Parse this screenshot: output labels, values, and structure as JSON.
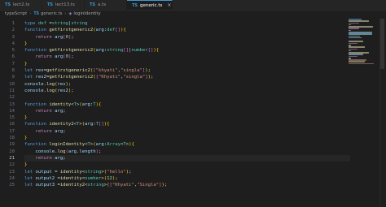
{
  "tabs": [
    {
      "label": "lect2.ts",
      "icon": "typescript-file-icon",
      "active": false
    },
    {
      "label": "lect13.ts",
      "icon": "typescript-file-icon",
      "active": false
    },
    {
      "label": "a.ts",
      "icon": "typescript-file-icon",
      "active": false
    },
    {
      "label": "generic.ts",
      "icon": "typescript-file-icon",
      "active": true,
      "close": "×"
    }
  ],
  "tab_icon_text": "TS",
  "breadcrumb": {
    "folder": "typeScript",
    "file": "generic.ts",
    "symbol": "loginIdentity"
  },
  "current_line": 21,
  "code_lines": [
    {
      "n": 1,
      "html": "<span class=\"kw\">type</span> <span class=\"ty\">def</span> <span class=\"pn\">=</span><span class=\"ty\">string</span><span class=\"pn\">|</span><span class=\"ty\">string</span>"
    },
    {
      "n": 2,
      "html": "<span class=\"kw\">function</span> <span class=\"fn\">getfirstgeneric2</span><span class=\"br1\">(</span><span class=\"var\">arg</span>:<span class=\"ty\">def</span><span class=\"br2\">[]</span><span class=\"br1\">)</span><span class=\"br1\">{</span>"
    },
    {
      "n": 3,
      "html": "    <span class=\"ctl\">return</span> <span class=\"var\">arg</span><span class=\"br2\">[</span><span class=\"num\">0</span><span class=\"br2\">]</span>;"
    },
    {
      "n": 4,
      "html": "<span class=\"br1\">}</span>"
    },
    {
      "n": 5,
      "html": "<span class=\"kw\">function</span> <span class=\"fn\">getfirstgeneric2</span><span class=\"br1\">(</span><span class=\"var\">arg</span>:<span class=\"ty\">string</span><span class=\"br2\">[]</span><span class=\"pn\">|</span><span class=\"ty\">number</span><span class=\"br2\">[]</span><span class=\"br1\">)</span><span class=\"br1\">{</span>"
    },
    {
      "n": 6,
      "html": "    <span class=\"ctl\">return</span> <span class=\"var\">arg</span><span class=\"br2\">[</span><span class=\"num\">0</span><span class=\"br2\">]</span>;"
    },
    {
      "n": 7,
      "html": "<span class=\"br1\">}</span>"
    },
    {
      "n": 8,
      "html": "<span class=\"kw\">let</span> <span class=\"var\">res</span><span class=\"pn\">=</span><span class=\"fn\">getfirstgeneric2</span><span class=\"br1\">(</span><span class=\"br2\">[</span><span class=\"str\">\"khyati\"</span>,<span class=\"str\">\"singla\"</span><span class=\"br2\">]</span><span class=\"br1\">)</span>;"
    },
    {
      "n": 9,
      "html": "<span class=\"kw\">let</span> <span class=\"var\">res2</span><span class=\"pn\">=</span><span class=\"fn\">getfirstgeneric2</span><span class=\"br1\">(</span><span class=\"br2\">[</span><span class=\"str\">\"Khyati\"</span>,<span class=\"str\">\"singla\"</span><span class=\"br2\">]</span><span class=\"br1\">)</span>;"
    },
    {
      "n": 10,
      "html": "<span class=\"var\">console</span>.<span class=\"fn\">log</span><span class=\"br1\">(</span><span class=\"var\">res</span><span class=\"br1\">)</span>;"
    },
    {
      "n": 11,
      "html": "<span class=\"var\">console</span>.<span class=\"fn\">log</span><span class=\"br1\">(</span><span class=\"var\">res2</span><span class=\"br1\">)</span>;"
    },
    {
      "n": 12,
      "html": ""
    },
    {
      "n": 13,
      "html": "<span class=\"kw\">function</span> <span class=\"fn\">identity</span><span class=\"pn\">&lt;</span><span class=\"ty\">T</span><span class=\"pn\">&gt;</span><span class=\"br1\">(</span><span class=\"var\">arg</span>:<span class=\"ty\">T</span><span class=\"br1\">)</span><span class=\"br1\">{</span>"
    },
    {
      "n": 14,
      "html": "    <span class=\"ctl\">return</span> <span class=\"var\">arg</span>;"
    },
    {
      "n": 15,
      "html": "<span class=\"br1\">}</span>"
    },
    {
      "n": 16,
      "html": "<span class=\"kw\">function</span> <span class=\"fn\">identity2</span><span class=\"pn\">&lt;</span><span class=\"ty\">T</span><span class=\"pn\">&gt;</span><span class=\"br1\">(</span><span class=\"var\">arg</span>:<span class=\"ty\">T</span><span class=\"br2\">[]</span><span class=\"br1\">)</span><span class=\"br1\">{</span>"
    },
    {
      "n": 17,
      "html": "    <span class=\"ctl\">return</span> <span class=\"var\">arg</span>;"
    },
    {
      "n": 18,
      "html": "<span class=\"br1\">}</span>"
    },
    {
      "n": 19,
      "html": "<span class=\"kw\">function</span> <span class=\"fn\">loginIdentity</span><span class=\"pn\">&lt;</span><span class=\"ty\">T</span><span class=\"pn\">&gt;</span><span class=\"br1\">(</span><span class=\"var\">arg</span>:<span class=\"ty\">Array</span><span class=\"pn\">&lt;</span><span class=\"ty\">T</span><span class=\"pn\">&gt;</span><span class=\"br1\">)</span><span class=\"br1\">{</span>"
    },
    {
      "n": 20,
      "html": "    <span class=\"var\">console</span>.<span class=\"fn\">log</span><span class=\"br2\">(</span><span class=\"var\">arg</span>.<span class=\"var\">length</span><span class=\"br2\">)</span>;"
    },
    {
      "n": 21,
      "html": "    <span class=\"ctl\">return</span> <span class=\"var\">arg</span>;"
    },
    {
      "n": 22,
      "html": "<span class=\"br1\">}</span>"
    },
    {
      "n": 23,
      "html": "<span class=\"kw\">let</span> <span class=\"var\">output</span> <span class=\"pn\">=</span> <span class=\"fn\">identity</span><span class=\"pn\">&lt;</span><span class=\"ty\">string</span><span class=\"pn\">&gt;</span><span class=\"br1\">(</span><span class=\"str\">\"hello\"</span><span class=\"br1\">)</span>;"
    },
    {
      "n": 24,
      "html": "<span class=\"kw\">let</span> <span class=\"var\">output2</span> <span class=\"pn\">=</span><span class=\"fn\">identity</span><span class=\"pn\">&lt;</span><span class=\"ty\">number</span><span class=\"pn\">&gt;</span><span class=\"br1\">(</span><span class=\"num\">12</span><span class=\"br1\">)</span>;"
    },
    {
      "n": 25,
      "html": "<span class=\"kw\">let</span> <span class=\"var\">output3</span> <span class=\"pn\">=</span><span class=\"fn\">identity2</span><span class=\"pn\">&lt;</span><span class=\"ty\">string</span><span class=\"pn\">&gt;</span><span class=\"br1\">(</span><span class=\"br2\">[</span><span class=\"str\">\"Khyati\"</span>,<span class=\"str\">\"Singla\"</span><span class=\"br2\">]</span><span class=\"br1\">)</span>;"
    }
  ],
  "minimap": [
    [
      "#569cd6",
      0.45
    ],
    [
      "#dcdcaa",
      0.7
    ],
    [
      "#c586c0",
      0.35
    ],
    [
      "#d4d4d4",
      0.08
    ],
    [
      "#dcdcaa",
      0.82
    ],
    [
      "#c586c0",
      0.35
    ],
    [
      "#d4d4d4",
      0.08
    ],
    [
      "#9cdcfe",
      0.8
    ],
    [
      "#9cdcfe",
      0.8
    ],
    [
      "#9cdcfe",
      0.4
    ],
    [
      "#9cdcfe",
      0.45
    ],
    [
      "#1e1e1e",
      0.0
    ],
    [
      "#dcdcaa",
      0.5
    ],
    [
      "#c586c0",
      0.3
    ],
    [
      "#d4d4d4",
      0.08
    ],
    [
      "#dcdcaa",
      0.55
    ],
    [
      "#c586c0",
      0.3
    ],
    [
      "#d4d4d4",
      0.08
    ],
    [
      "#dcdcaa",
      0.7
    ],
    [
      "#9cdcfe",
      0.5
    ],
    [
      "#c586c0",
      0.3
    ],
    [
      "#d4d4d4",
      0.08
    ],
    [
      "#ce9178",
      0.6
    ],
    [
      "#b5cea8",
      0.55
    ],
    [
      "#ce9178",
      0.85
    ]
  ]
}
